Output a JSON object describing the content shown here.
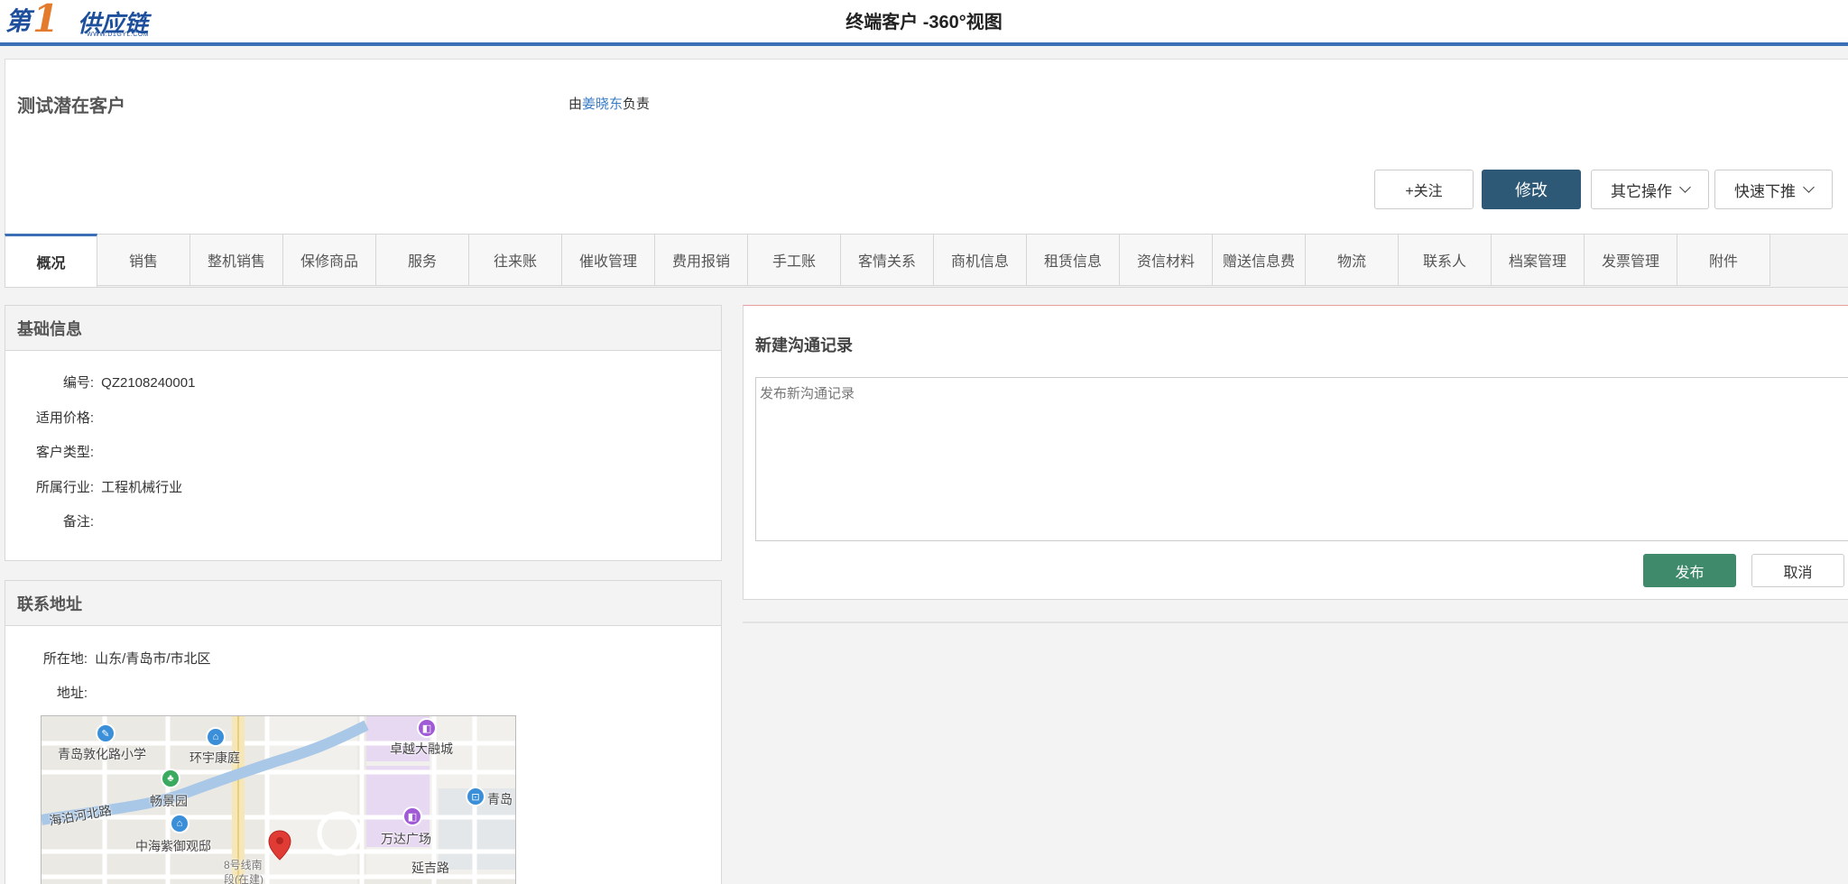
{
  "header": {
    "logo_mark": "第",
    "logo_num": "1",
    "logo_name": "供应链",
    "logo_url": "WWW.D1GYL.COM",
    "title": "终端客户 -360°视图"
  },
  "customer": {
    "name": "测试潜在客户",
    "owner_prefix": "由",
    "owner_name": "姜晓东",
    "owner_suffix": "负责"
  },
  "actions": {
    "follow": "+关注",
    "edit": "修改",
    "other": "其它操作",
    "quick": "快速下推"
  },
  "tabs": [
    "概况",
    "销售",
    "整机销售",
    "保修商品",
    "服务",
    "往来账",
    "催收管理",
    "费用报销",
    "手工账",
    "客情关系",
    "商机信息",
    "租赁信息",
    "资信材料",
    "赠送信息费",
    "物流",
    "联系人",
    "档案管理",
    "发票管理",
    "附件"
  ],
  "basic_info": {
    "title": "基础信息",
    "fields": [
      {
        "label": "编号:",
        "value": "QZ2108240001"
      },
      {
        "label": "适用价格:",
        "value": ""
      },
      {
        "label": "客户类型:",
        "value": ""
      },
      {
        "label": "所属行业:",
        "value": "工程机械行业"
      },
      {
        "label": "备注:",
        "value": ""
      }
    ]
  },
  "address": {
    "title": "联系地址",
    "location_label": "所在地:",
    "location_value": "山东/青岛市/市北区",
    "address_label": "地址:",
    "address_value": "",
    "map_labels": {
      "school": "青岛敦化路小学",
      "huanyu": "环宇康庭",
      "zhuoyue": "卓越大融城",
      "haibo": "海泊河北路",
      "changjing": "畅景园",
      "qingdao": "青岛",
      "wanda": "万达广场",
      "zhonghai": "中海紫御观邸",
      "line8": "8号线南",
      "line8b": "段(在建)",
      "yanji": "延吉路"
    }
  },
  "comm": {
    "title": "新建沟通记录",
    "placeholder": "发布新沟通记录",
    "publish": "发布",
    "cancel": "取消"
  },
  "colors": {
    "brand_blue": "#3a6fb5",
    "edit_button": "#2d5876",
    "publish_button": "#3e8a6b",
    "link": "#3a7cc4"
  }
}
